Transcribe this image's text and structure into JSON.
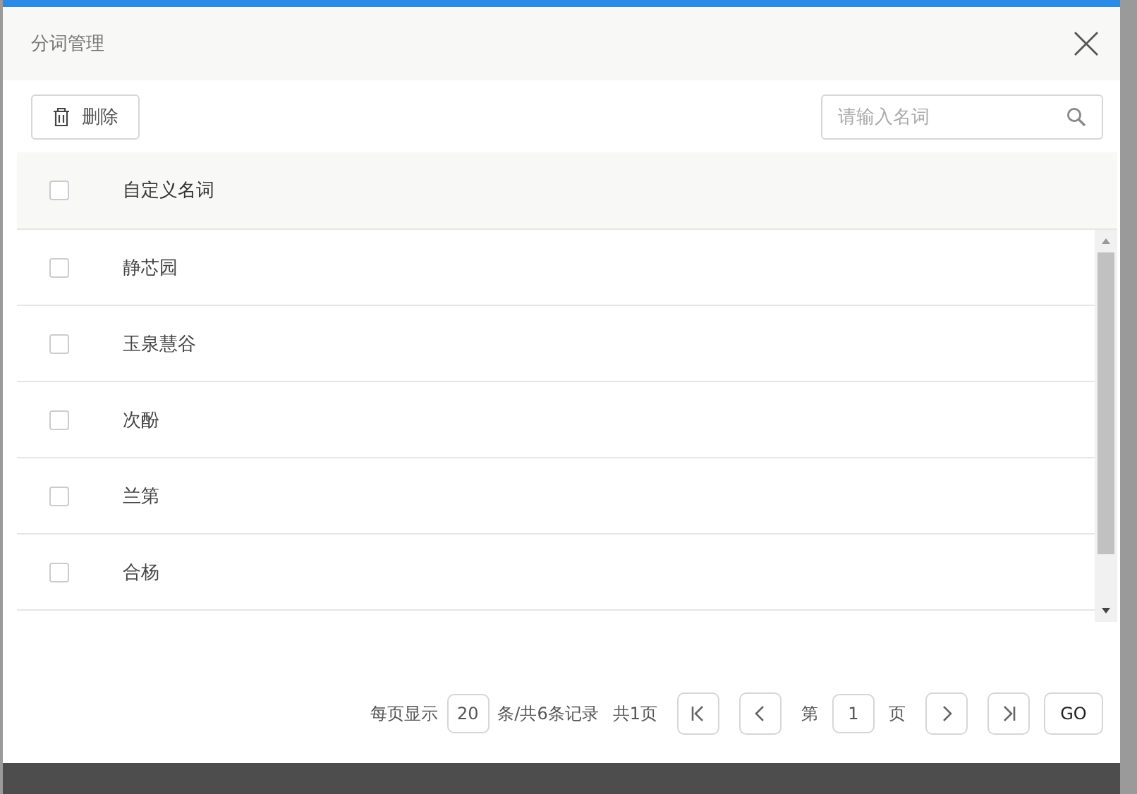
{
  "dialog": {
    "title": "分词管理"
  },
  "toolbar": {
    "delete_button": "删除",
    "search": {
      "placeholder": "请输入名词"
    }
  },
  "table": {
    "header": {
      "checked": false,
      "column": "自定义名词"
    },
    "rows": [
      {
        "name": "静芯园",
        "checked": false
      },
      {
        "name": "玉泉慧谷",
        "checked": false
      },
      {
        "name": "次酚",
        "checked": false
      },
      {
        "name": "兰第",
        "checked": false
      },
      {
        "name": "合杨",
        "checked": false
      }
    ]
  },
  "pagination": {
    "per_page_label": "每页显示",
    "per_page": "20",
    "records": "条/共6条记录",
    "total_pages": "共1页",
    "page_prefix": "第",
    "page": "1",
    "page_suffix": "页",
    "go": "GO"
  }
}
